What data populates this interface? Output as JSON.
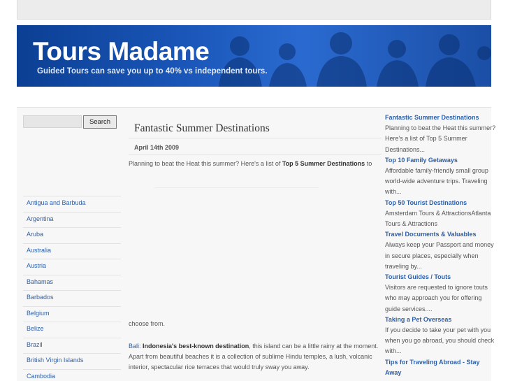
{
  "header": {
    "site_title": "Tours Madame",
    "tagline": "Guided Tours can save you up to 40% vs independent tours."
  },
  "search": {
    "value": "",
    "button_label": "Search"
  },
  "countries": [
    "Antigua and Barbuda",
    "Argentina",
    "Aruba",
    "Australia",
    "Austria",
    "Bahamas",
    "Barbados",
    "Belgium",
    "Belize",
    "Brazil",
    "British Virgin Islands",
    "Cambodia"
  ],
  "post": {
    "title": "Fantastic Summer Destinations",
    "date": "April 14th 2009",
    "intro_before": "Planning to beat the Heat this summer? Here's a list of ",
    "intro_bold": "Top 5 Summer Destinations",
    "intro_after": " to",
    "choose_from": "choose from.",
    "bali_link": "Bali",
    "bali_colon": ": ",
    "bali_bold": "Indonesia's best-known destination",
    "bali_text": ", this island can be a little rainy at the moment. Apart from beautiful beaches it is a collection of sublime Hindu temples, a lush, volcanic interior, spectacular rice terraces that would truly sway you away."
  },
  "sidebar": {
    "entries": [
      {
        "title": "Fantastic Summer Destinations",
        "text": "Planning to beat the Heat this summer? Here's a list of Top 5 Summer Destinations..."
      },
      {
        "title": "Top 10 Family Getaways",
        "text": "Affordable family-friendly small group world-wide adventure trips. Traveling with..."
      },
      {
        "title": "Top 50 Tourist Destinations",
        "text": "Amsterdam Tours & AttractionsAtlanta Tours & Attractions"
      },
      {
        "title": "Travel Documents & Valuables",
        "text": "Always keep your Passport and money in secure places, especially when traveling by..."
      },
      {
        "title": "Tourist Guides / Touts",
        "text": "Visitors are requested to ignore touts who may approach you for offering guide services...."
      },
      {
        "title": "Taking a Pet Overseas",
        "text": "If you decide to take your pet with you when you go abroad, you should check with..."
      },
      {
        "title": "Tips for Traveling Abroad - Stay Away",
        "text": ""
      }
    ]
  }
}
